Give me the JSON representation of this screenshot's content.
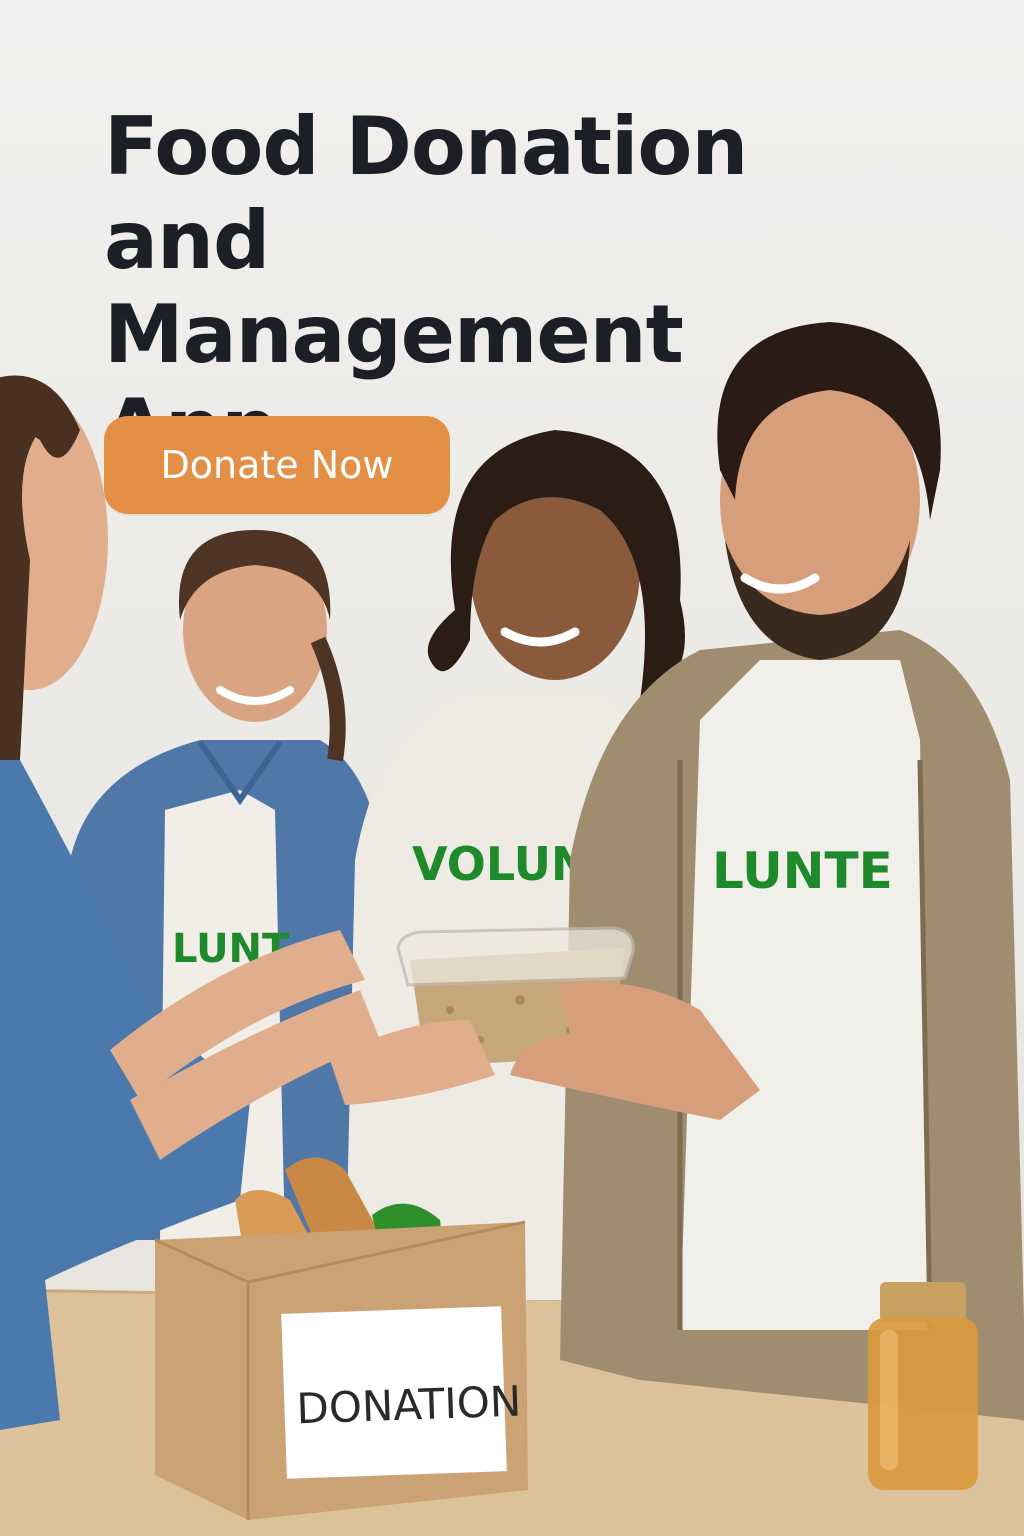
{
  "hero": {
    "title_line1": "Food Donation",
    "title_line2": "and Management",
    "title_line3": "App",
    "cta_label": "Donate Now"
  },
  "photo": {
    "shirt_text_center": "VOLUNTE",
    "shirt_text_right": "LUNTE",
    "shirt_text_left": "LUNT",
    "box_label": "DONATION"
  },
  "colors": {
    "cta": "#e38f45",
    "shirt_print": "#1f8a2c",
    "title": "#1c1f26"
  }
}
